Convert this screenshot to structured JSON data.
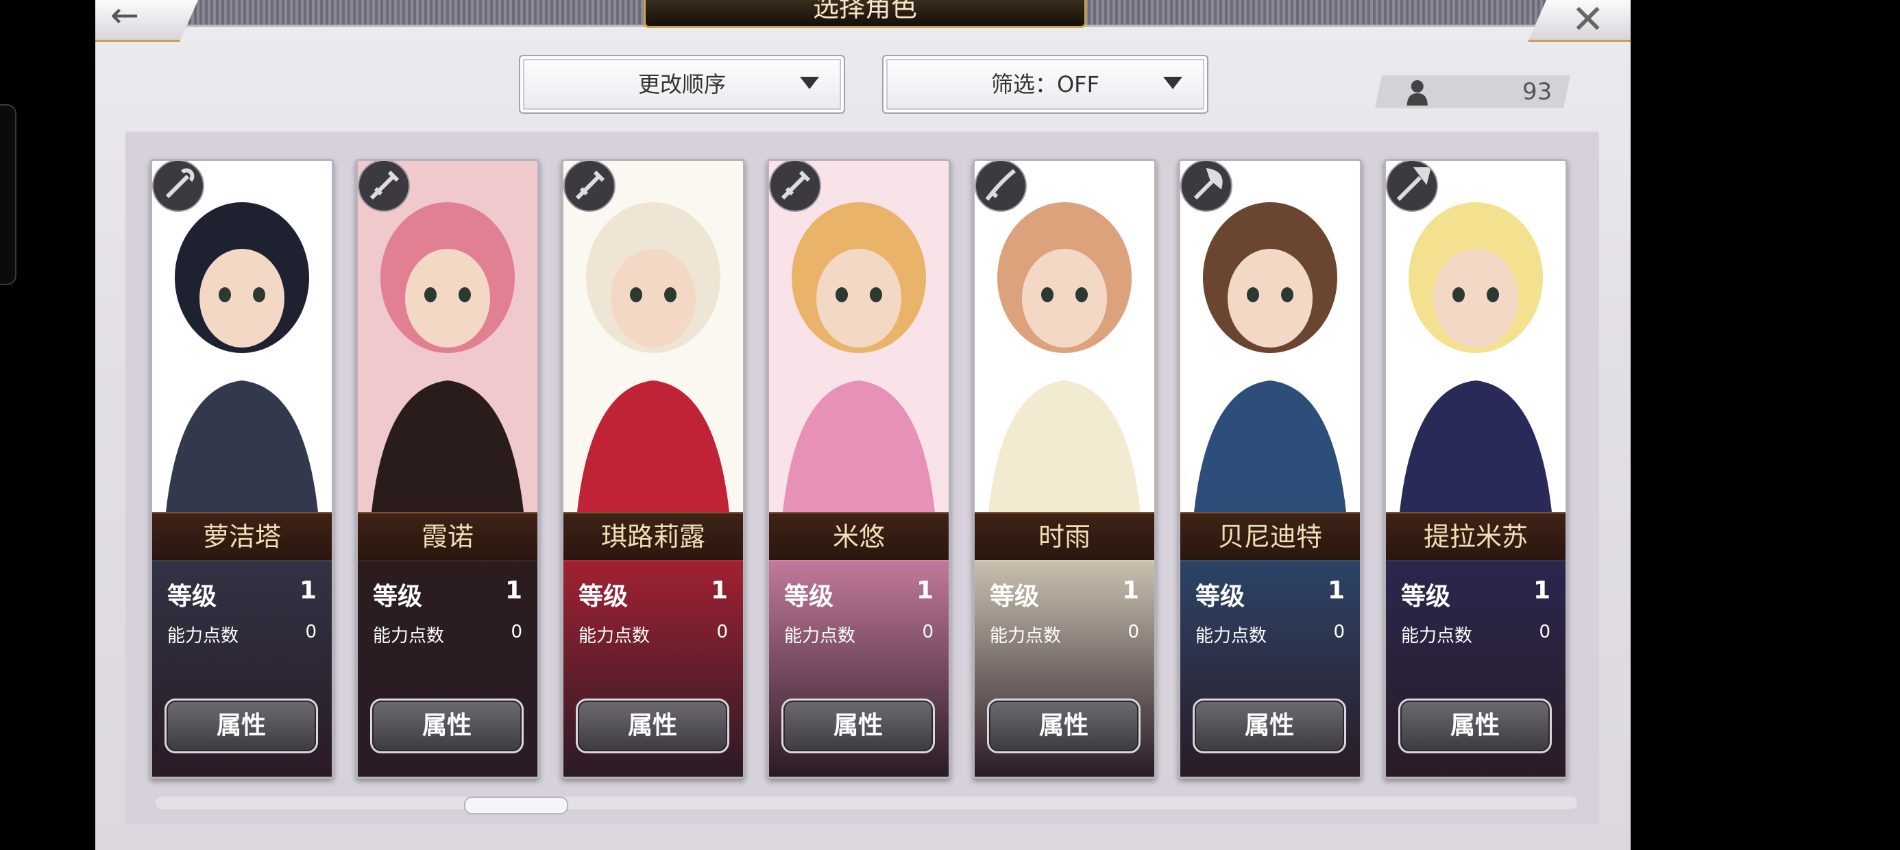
{
  "header": {
    "title": "选择角色"
  },
  "toolbar": {
    "sort_label": "更改顺序",
    "filter_label": "筛选：OFF"
  },
  "roster": {
    "count": "93"
  },
  "labels": {
    "level": "等级",
    "ability_points": "能力点数",
    "attributes": "属性"
  },
  "characters": [
    {
      "name": "萝洁塔",
      "level": "1",
      "ability_points": "0",
      "weapon": "staff-icon",
      "palette": [
        "#1e2230",
        "#33394c",
        "#ffffff"
      ]
    },
    {
      "name": "霞诺",
      "level": "1",
      "ability_points": "0",
      "weapon": "sword-icon",
      "palette": [
        "#e17f93",
        "#2b1c1c",
        "#f0c9cc"
      ]
    },
    {
      "name": "琪路莉露",
      "level": "1",
      "ability_points": "0",
      "weapon": "sword-icon",
      "palette": [
        "#efe5d4",
        "#bf2335",
        "#fbf8f1"
      ]
    },
    {
      "name": "米悠",
      "level": "1",
      "ability_points": "0",
      "weapon": "sword-icon",
      "palette": [
        "#e9b46a",
        "#e891b8",
        "#fae3e8"
      ]
    },
    {
      "name": "时雨",
      "level": "1",
      "ability_points": "0",
      "weapon": "katana-icon",
      "palette": [
        "#dca27c",
        "#f2ead1",
        "#ffffff"
      ]
    },
    {
      "name": "贝尼迪特",
      "level": "1",
      "ability_points": "0",
      "weapon": "axe-icon",
      "palette": [
        "#6a4630",
        "#2d4e78",
        "#ffffff"
      ]
    },
    {
      "name": "提拉米苏",
      "level": "1",
      "ability_points": "0",
      "weapon": "spear-icon",
      "palette": [
        "#f4e190",
        "#2a2a58",
        "#ffffff"
      ]
    }
  ]
}
